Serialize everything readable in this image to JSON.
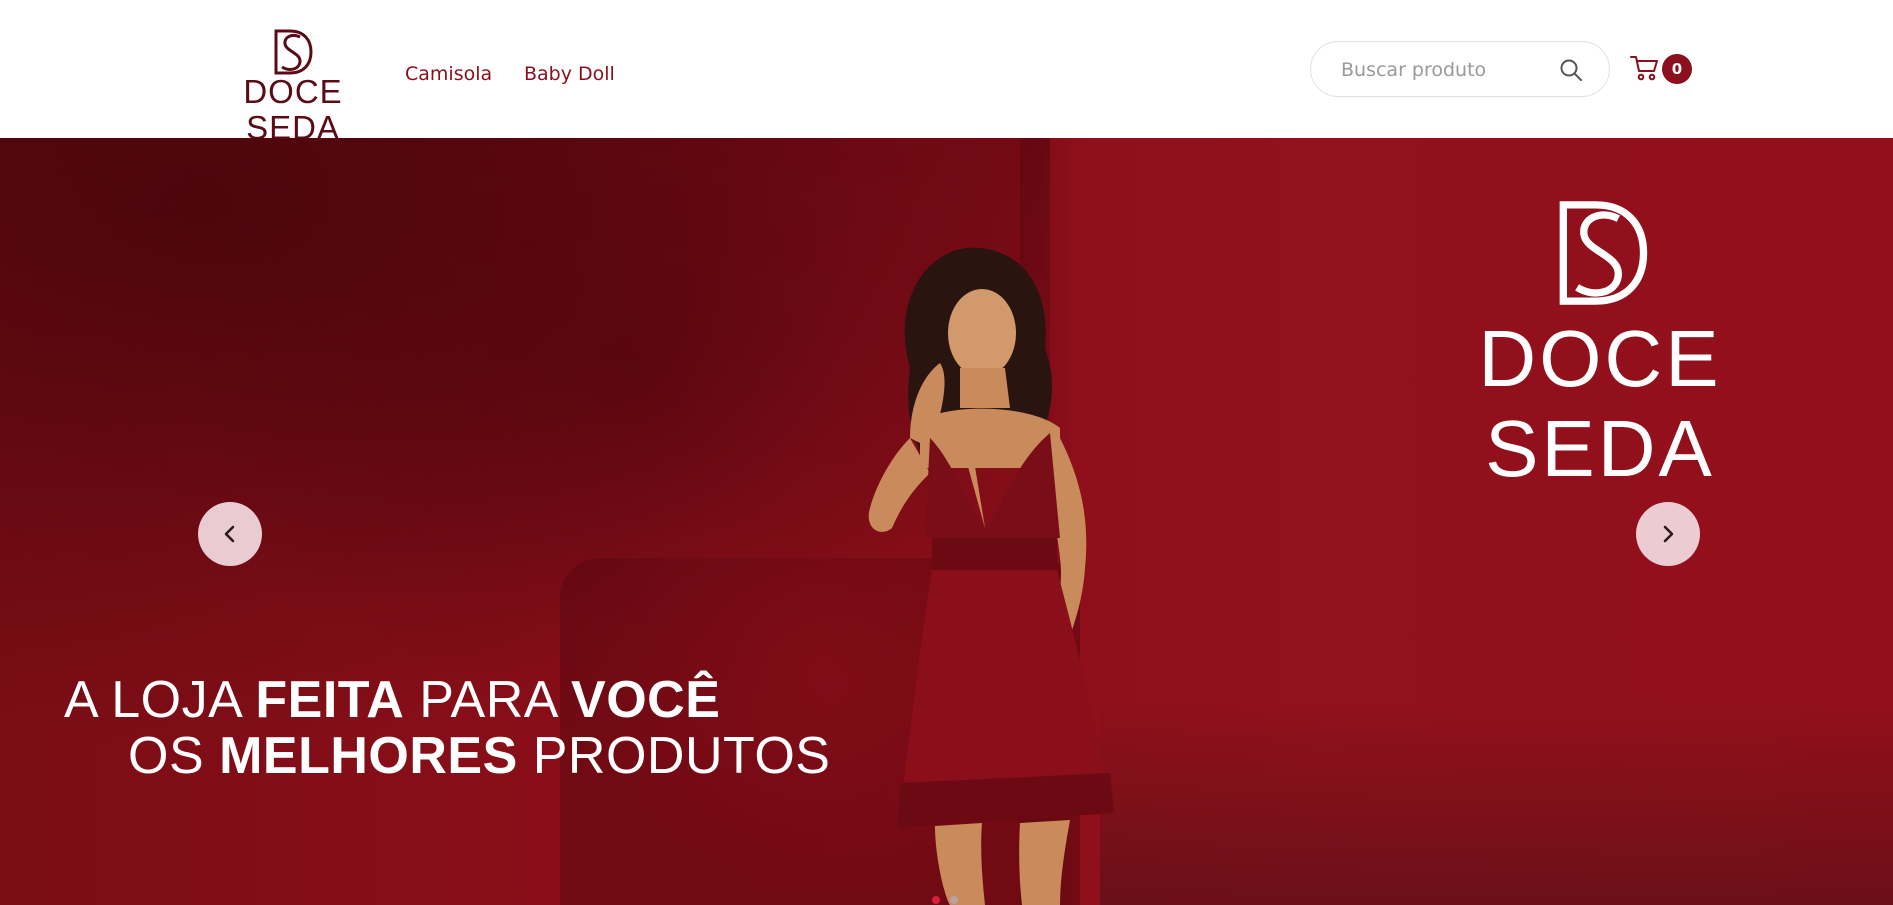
{
  "brand": {
    "name": "Doce Seda",
    "logo_monogram": "DS",
    "logo_word": "DOCE SEDA"
  },
  "nav": {
    "items": [
      {
        "label": "Camisola"
      },
      {
        "label": "Baby Doll"
      }
    ]
  },
  "search": {
    "placeholder": "Buscar produto",
    "value": "",
    "icon": "search-icon"
  },
  "cart": {
    "icon": "cart-icon",
    "count": "0"
  },
  "hero": {
    "headline": {
      "line1_a": "A LOJA ",
      "line1_b": "FEITA",
      "line1_c": " PARA ",
      "line1_d": "VOCÊ",
      "line2_a": "OS ",
      "line2_b": "MELHORES",
      "line2_c": " PRODUTOS"
    },
    "logo_monogram": "DS",
    "logo_word": "DOCE SEDA",
    "prev_icon": "chevron-left-icon",
    "next_icon": "chevron-right-icon",
    "slides": 2,
    "active_slide": 1
  },
  "colors": {
    "brand_red": "#8b0f1c",
    "logo_dark": "#5b0b16",
    "hero_bg": "#8e0f1a",
    "arrow_bg": "#f0d6dc",
    "dot_active": "#d61f3a"
  }
}
